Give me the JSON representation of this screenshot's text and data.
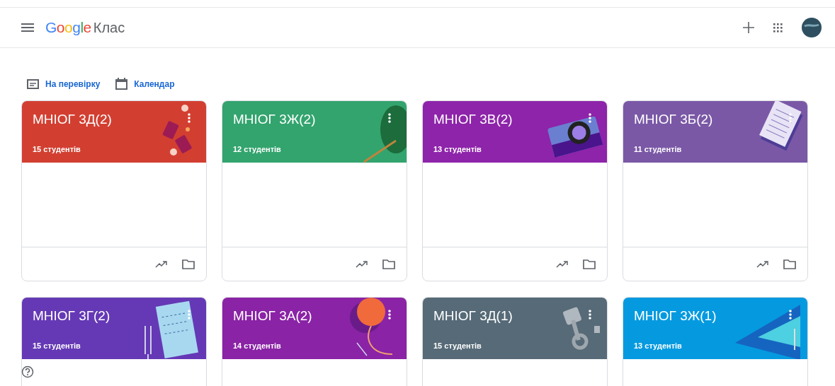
{
  "app_bar": {
    "logo_brand": "Google",
    "logo_product": "Клас"
  },
  "nav_links": [
    {
      "label": "На перевірку",
      "kind": "review"
    },
    {
      "label": "Календар",
      "kind": "calendar"
    }
  ],
  "classes": [
    {
      "name": "МНІОГ 3Д(2)",
      "students": "15 студентів",
      "color": "#d23f31",
      "kind": "tickets"
    },
    {
      "name": "МНІОГ 3Ж(2)",
      "students": "12 студентів",
      "color": "#33a46e",
      "kind": "plant"
    },
    {
      "name": "МНІОГ 3В(2)",
      "students": "13 студентів",
      "color": "#8e24aa",
      "kind": "camera"
    },
    {
      "name": "МНІОГ 3Б(2)",
      "students": "11 студентів",
      "color": "#7a58a6",
      "kind": "notebook"
    },
    {
      "name": "МНІОГ 3Г(2)",
      "students": "15 студентів",
      "color": "#6539b5",
      "kind": "music"
    },
    {
      "name": "МНІОГ 3А(2)",
      "students": "14 студентів",
      "color": "#8a23a6",
      "kind": "yarn"
    },
    {
      "name": "МНІОГ 3Д(1)",
      "students": "15 студентів",
      "color": "#566a77",
      "kind": "piston"
    },
    {
      "name": "МНІОГ 3Ж(1)",
      "students": "13 студентів",
      "color": "#059ae0",
      "kind": "pool"
    }
  ]
}
